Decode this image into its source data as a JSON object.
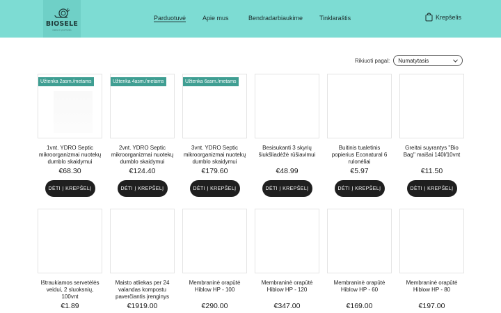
{
  "brand": {
    "name": "BIOSELE",
    "tagline": "nature in your hands"
  },
  "nav": {
    "items": [
      {
        "label": "Parduotuvė",
        "active": true
      },
      {
        "label": "Apie mus",
        "active": false
      },
      {
        "label": "Bendradarbiaukime",
        "active": false
      },
      {
        "label": "Tinklaraštis",
        "active": false
      }
    ]
  },
  "cart": {
    "label": "Krepšelis",
    "icon": "shopping-bag-icon"
  },
  "sort": {
    "label": "Rikiuoti pagal:",
    "selected": "Numatytasis"
  },
  "colors": {
    "header": "#7ddcd3",
    "badge": "#3f9e92",
    "button": "#1f1f1f"
  },
  "products": [
    {
      "badge": "Užtenka 2asm./metams",
      "title": "1vnt. YDRO Septic mikroorganizmai nuotekų dumblo skaidymui",
      "price": "€68.30",
      "button": "DĖTI Į KREPŠELĮ"
    },
    {
      "badge": "Užtenka 4asm./metams",
      "title": "2vnt. YDRO Septic mikroorganizmai nuotekų dumblo skaidymui",
      "price": "€124.40",
      "button": "DĖTI Į KREPŠELĮ"
    },
    {
      "badge": "Užtenka 6asm./metams",
      "title": "3vnt. YDRO Septic mikroorganizmai nuotekų dumblo skaidymui",
      "price": "€179.60",
      "button": "DĖTI Į KREPŠELĮ"
    },
    {
      "badge": "",
      "title": "Besisukanti 3 skyrių šiukšliadėžė rūšiavimui",
      "price": "€48.99",
      "button": "DĖTI Į KREPŠELĮ"
    },
    {
      "badge": "",
      "title": "Buitinis tualetinis popierius Econatural 6 rulonėliai",
      "price": "€5.97",
      "button": "DĖTI Į KREPŠELĮ"
    },
    {
      "badge": "",
      "title": "Greitai suyrantys \"Bio Bag\" maišai 140l/10vnt",
      "price": "€11.50",
      "button": "DĖTI Į KREPŠELĮ"
    },
    {
      "badge": "",
      "title": "Ištraukiamos servetėlės veidui, 2 sluoksnių, 100vnt",
      "price": "€1.89",
      "button": ""
    },
    {
      "badge": "",
      "title": "Maisto atliekas per 24 valandas kompostu paverčiantis įrenginys",
      "price": "€1919.00",
      "button": ""
    },
    {
      "badge": "",
      "title": "Membraninė orapūtė Hiblow HP - 100",
      "price": "€290.00",
      "button": ""
    },
    {
      "badge": "",
      "title": "Membraninė orapūtė Hiblow HP - 120",
      "price": "€347.00",
      "button": ""
    },
    {
      "badge": "",
      "title": "Membraninė orapūtė Hiblow HP - 60",
      "price": "€169.00",
      "button": ""
    },
    {
      "badge": "",
      "title": "Membraninė orapūtė Hiblow HP - 80",
      "price": "€197.00",
      "button": ""
    }
  ]
}
